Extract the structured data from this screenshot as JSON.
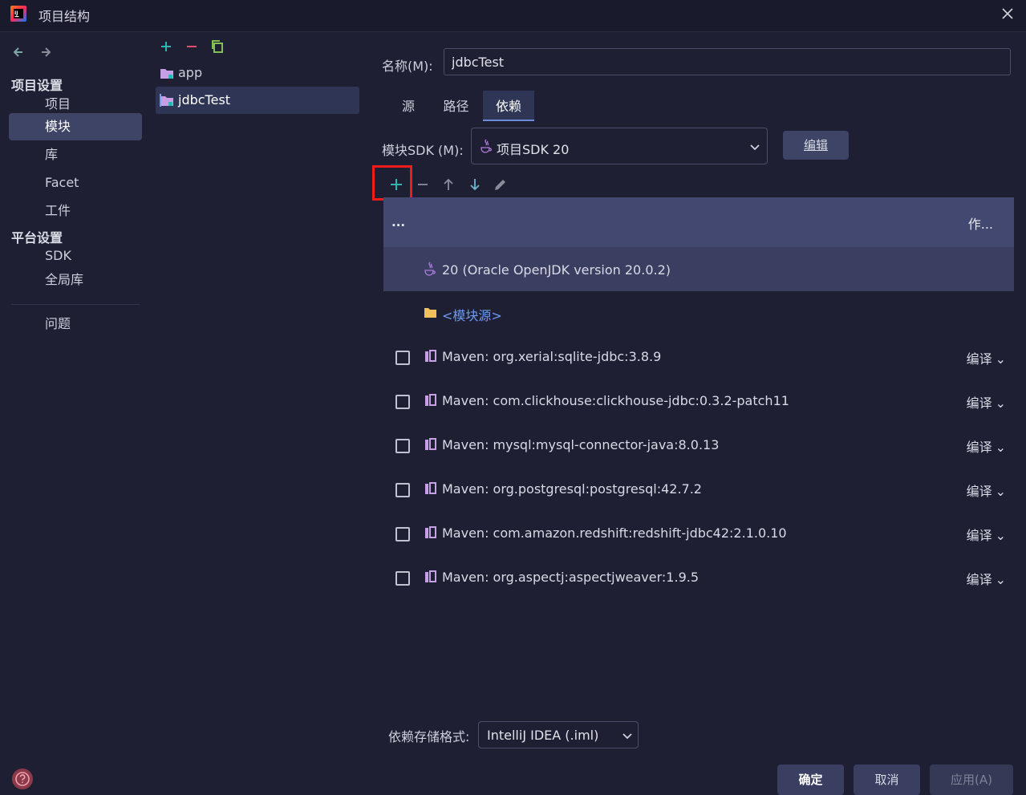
{
  "window": {
    "title": "项目结构",
    "logo_icon": "intellij-logo-icon",
    "close_icon": "close-icon"
  },
  "left_nav": {
    "back_icon": "arrow-left-icon",
    "forward_icon": "arrow-right-icon",
    "project_settings_header": "项目设置",
    "project_settings_items": [
      "项目",
      "模块",
      "库",
      "Facet",
      "工件"
    ],
    "platform_settings_header": "平台设置",
    "platform_settings_items": [
      "SDK",
      "全局库"
    ],
    "problems": "问题",
    "selected": "模块"
  },
  "modules": {
    "toolbar_icons": [
      "add-icon",
      "remove-icon",
      "copy-icon"
    ],
    "items": [
      {
        "name": "app",
        "selected": false
      },
      {
        "name": "jdbcTest",
        "selected": true
      }
    ]
  },
  "main": {
    "name_label": "名称(M):",
    "name_value": "jdbcTest",
    "tabs": [
      {
        "label": "源",
        "active": false
      },
      {
        "label": "路径",
        "active": false
      },
      {
        "label": "依赖",
        "active": true
      }
    ],
    "sdk_label": "模块SDK (M):",
    "sdk_value": "项目SDK 20",
    "edit_button": "编辑",
    "dep_toolbar_icons": [
      "add-icon",
      "remove-icon",
      "move-up-icon",
      "move-down-icon",
      "edit-pencil-icon"
    ],
    "table": {
      "col_dots": "...",
      "col_scope": "作...",
      "sdk_row": "20 (Oracle OpenJDK version 20.0.2)",
      "module_source_row": "<模块源>",
      "dependencies": [
        {
          "name": "Maven: org.xerial:sqlite-jdbc:3.8.9",
          "scope": "编译"
        },
        {
          "name": "Maven: com.clickhouse:clickhouse-jdbc:0.3.2-patch11",
          "scope": "编译"
        },
        {
          "name": "Maven: mysql:mysql-connector-java:8.0.13",
          "scope": "编译"
        },
        {
          "name": "Maven: org.postgresql:postgresql:42.7.2",
          "scope": "编译"
        },
        {
          "name": "Maven: com.amazon.redshift:redshift-jdbc42:2.1.0.10",
          "scope": "编译"
        },
        {
          "name": "Maven: org.aspectj:aspectjweaver:1.9.5",
          "scope": "编译"
        }
      ]
    },
    "storage_format_label": "依赖存储格式:",
    "storage_format_value": "IntelliJ IDEA (.iml)"
  },
  "footer": {
    "ok": "确定",
    "cancel": "取消",
    "apply": "应用(A)",
    "help_icon": "help-icon"
  },
  "colors": {
    "background": "#1e1f33",
    "selection": "#3e4466",
    "accent_teal": "#2fb5b0",
    "accent_red": "#e0506a",
    "highlight_box": "#f01c1c",
    "link": "#6c9bf0"
  }
}
